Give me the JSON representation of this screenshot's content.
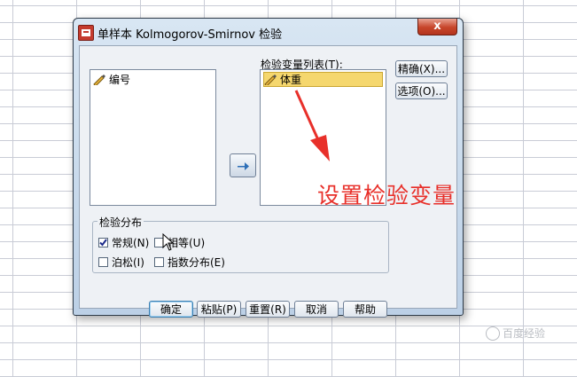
{
  "dialog": {
    "title": "单样本 Kolmogorov-Smirnov 检验",
    "close_label": "x"
  },
  "source_list": {
    "items": [
      {
        "label": "编号",
        "icon": "ruler-pencil-icon"
      }
    ]
  },
  "test_list": {
    "label": "检验变量列表(T):",
    "items": [
      {
        "label": "体重",
        "icon": "ruler-pencil-icon",
        "selected": true
      }
    ]
  },
  "side_buttons": {
    "exact": "精确(X)...",
    "options": "选项(O)..."
  },
  "distribution": {
    "title": "检验分布",
    "normal": {
      "label": "常规(N)",
      "checked": true
    },
    "uniform": {
      "label": "相等(U)",
      "checked": false
    },
    "poisson": {
      "label": "泊松(I)",
      "checked": false
    },
    "exponential": {
      "label": "指数分布(E)",
      "checked": false
    }
  },
  "bottom_buttons": {
    "ok": "确定",
    "paste": "粘贴(P)",
    "reset": "重置(R)",
    "cancel": "取消",
    "help": "帮助"
  },
  "annotation": {
    "text": "设置检验变量",
    "color": "#e8302a"
  },
  "watermark": {
    "text": "百度经验"
  },
  "colors": {
    "selection": "#f5d76e",
    "close": "#c7452a",
    "grid": "#c9ccd6"
  }
}
